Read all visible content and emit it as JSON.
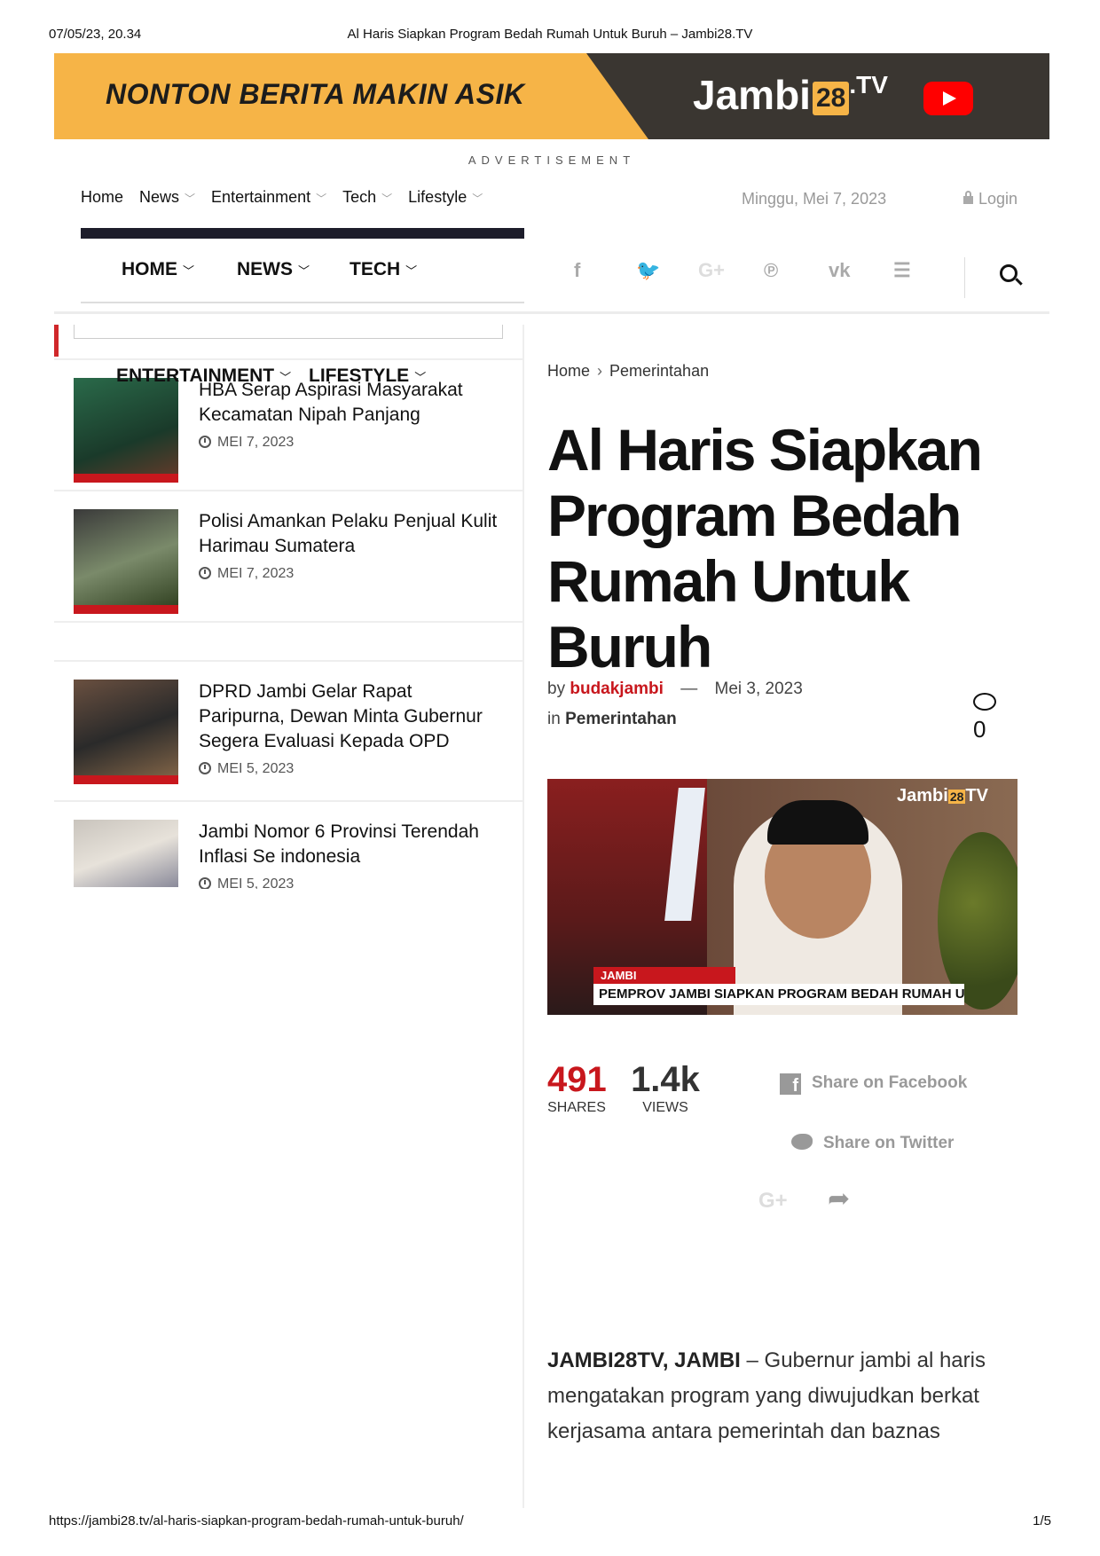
{
  "print": {
    "datetime": "07/05/23, 20.34",
    "doc_title": "Al Haris Siapkan Program Bedah Rumah Untuk Buruh – Jambi28.TV",
    "url": "https://jambi28.tv/al-haris-siapkan-program-bedah-rumah-untuk-buruh/",
    "page": "1/5"
  },
  "banner": {
    "slogan": "NONTON BERITA MAKIN ASIK",
    "logo_text": "Jambi",
    "logo_num": "28",
    "logo_suffix": ".TV",
    "youtube_icon": "youtube-play-icon"
  },
  "ad_label": "ADVERTISEMENT",
  "topnav": {
    "items": [
      {
        "label": "Home"
      },
      {
        "label": "News"
      },
      {
        "label": "Entertainment"
      },
      {
        "label": "Tech"
      },
      {
        "label": "Lifestyle"
      }
    ],
    "date": "Minggu, Mei 7, 2023",
    "login": "Login"
  },
  "mainnav": {
    "items": [
      {
        "label": "HOME"
      },
      {
        "label": "NEWS"
      },
      {
        "label": "TECH"
      },
      {
        "label": "ENTERTAINMENT"
      },
      {
        "label": "LIFESTYLE"
      }
    ],
    "social_icons": [
      "facebook-icon",
      "twitter-icon",
      "google-plus-icon",
      "pinterest-icon",
      "vk-icon",
      "rss-icon"
    ],
    "social_glyphs": {
      "facebook": "f",
      "twitter": "🐦",
      "gplus": "G+",
      "pinterest": "℗",
      "vk": "vk",
      "rss": "☰"
    }
  },
  "sidebar": {
    "posts": [
      {
        "title": "HBA Serap Aspirasi Masyarakat Kecamatan Nipah Panjang",
        "date": "MEI 7, 2023"
      },
      {
        "title": "Polisi Amankan Pelaku Penjual Kulit Harimau Sumatera",
        "date": "MEI 7, 2023"
      },
      {
        "title": "DPRD Jambi Gelar Rapat Paripurna, Dewan Minta Gubernur Segera Evaluasi Kepada OPD",
        "date": "MEI 5, 2023"
      },
      {
        "title": "Jambi Nomor 6 Provinsi Terendah Inflasi Se indonesia",
        "date": "MEI 5, 2023"
      }
    ]
  },
  "article": {
    "breadcrumb": {
      "home": "Home",
      "category": "Pemerintahan"
    },
    "headline": "Al Haris Siapkan Program Bedah Rumah Untuk Buruh",
    "by_label": "by",
    "author": "budakjambi",
    "dash": "—",
    "date": "Mei 3, 2023",
    "in_label": "in",
    "category": "Pemerintahan",
    "comment_count": "0",
    "image": {
      "watermark": "Jambi",
      "watermark_num": "28",
      "watermark_suffix": "TV",
      "tag": "JAMBI",
      "caption": "PEMPROV JAMBI SIAPKAN PROGRAM BEDAH RUMAH UNTUK BURUH"
    },
    "shares_count": "491",
    "shares_label": "SHARES",
    "views_count": "1.4k",
    "views_label": "VIEWS",
    "share_facebook": "Share on Facebook",
    "share_twitter": "Share on Twitter",
    "gplus_glyph": "G+",
    "forward_glyph": "➦",
    "lede_strong": "JAMBI28TV, JAMBI",
    "lede_text": " – Gubernur jambi al haris mengatakan program yang diwujudkan berkat kerjasama antara pemerintah dan baznas"
  },
  "colors": {
    "accent": "#c8171d",
    "banner_yellow": "#f6b447",
    "banner_dark": "#3a3631"
  }
}
